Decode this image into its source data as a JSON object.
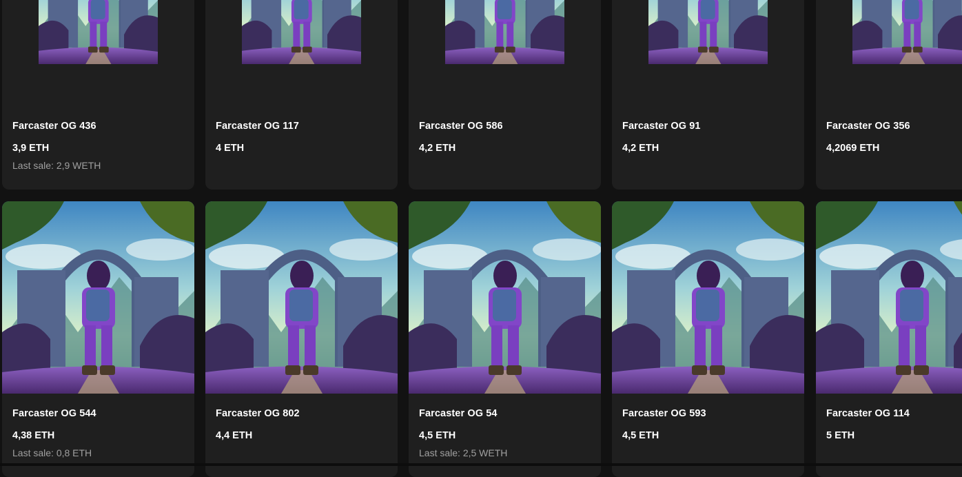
{
  "artwork_icon": "nft-artwork-astronaut-purple-suit",
  "colors": {
    "background": "#121212",
    "card": "#1f1f1f",
    "muted_text": "#a0a0a0"
  },
  "cards": [
    {
      "name": "Farcaster OG 436",
      "price": "3,9 ETH",
      "last_sale": "Last sale: 2,9 WETH"
    },
    {
      "name": "Farcaster OG 117",
      "price": "4 ETH",
      "last_sale": ""
    },
    {
      "name": "Farcaster OG 586",
      "price": "4,2 ETH",
      "last_sale": ""
    },
    {
      "name": "Farcaster OG 91",
      "price": "4,2 ETH",
      "last_sale": ""
    },
    {
      "name": "Farcaster OG 356",
      "price": "4,2069 ETH",
      "last_sale": ""
    },
    {
      "name": "Farcaster OG 544",
      "price": "4,38 ETH",
      "last_sale": "Last sale: 0,8 ETH"
    },
    {
      "name": "Farcaster OG 802",
      "price": "4,4 ETH",
      "last_sale": ""
    },
    {
      "name": "Farcaster OG 54",
      "price": "4,5 ETH",
      "last_sale": "Last sale: 2,5 WETH"
    },
    {
      "name": "Farcaster OG 593",
      "price": "4,5 ETH",
      "last_sale": ""
    },
    {
      "name": "Farcaster OG 114",
      "price": "5 ETH",
      "last_sale": ""
    }
  ]
}
